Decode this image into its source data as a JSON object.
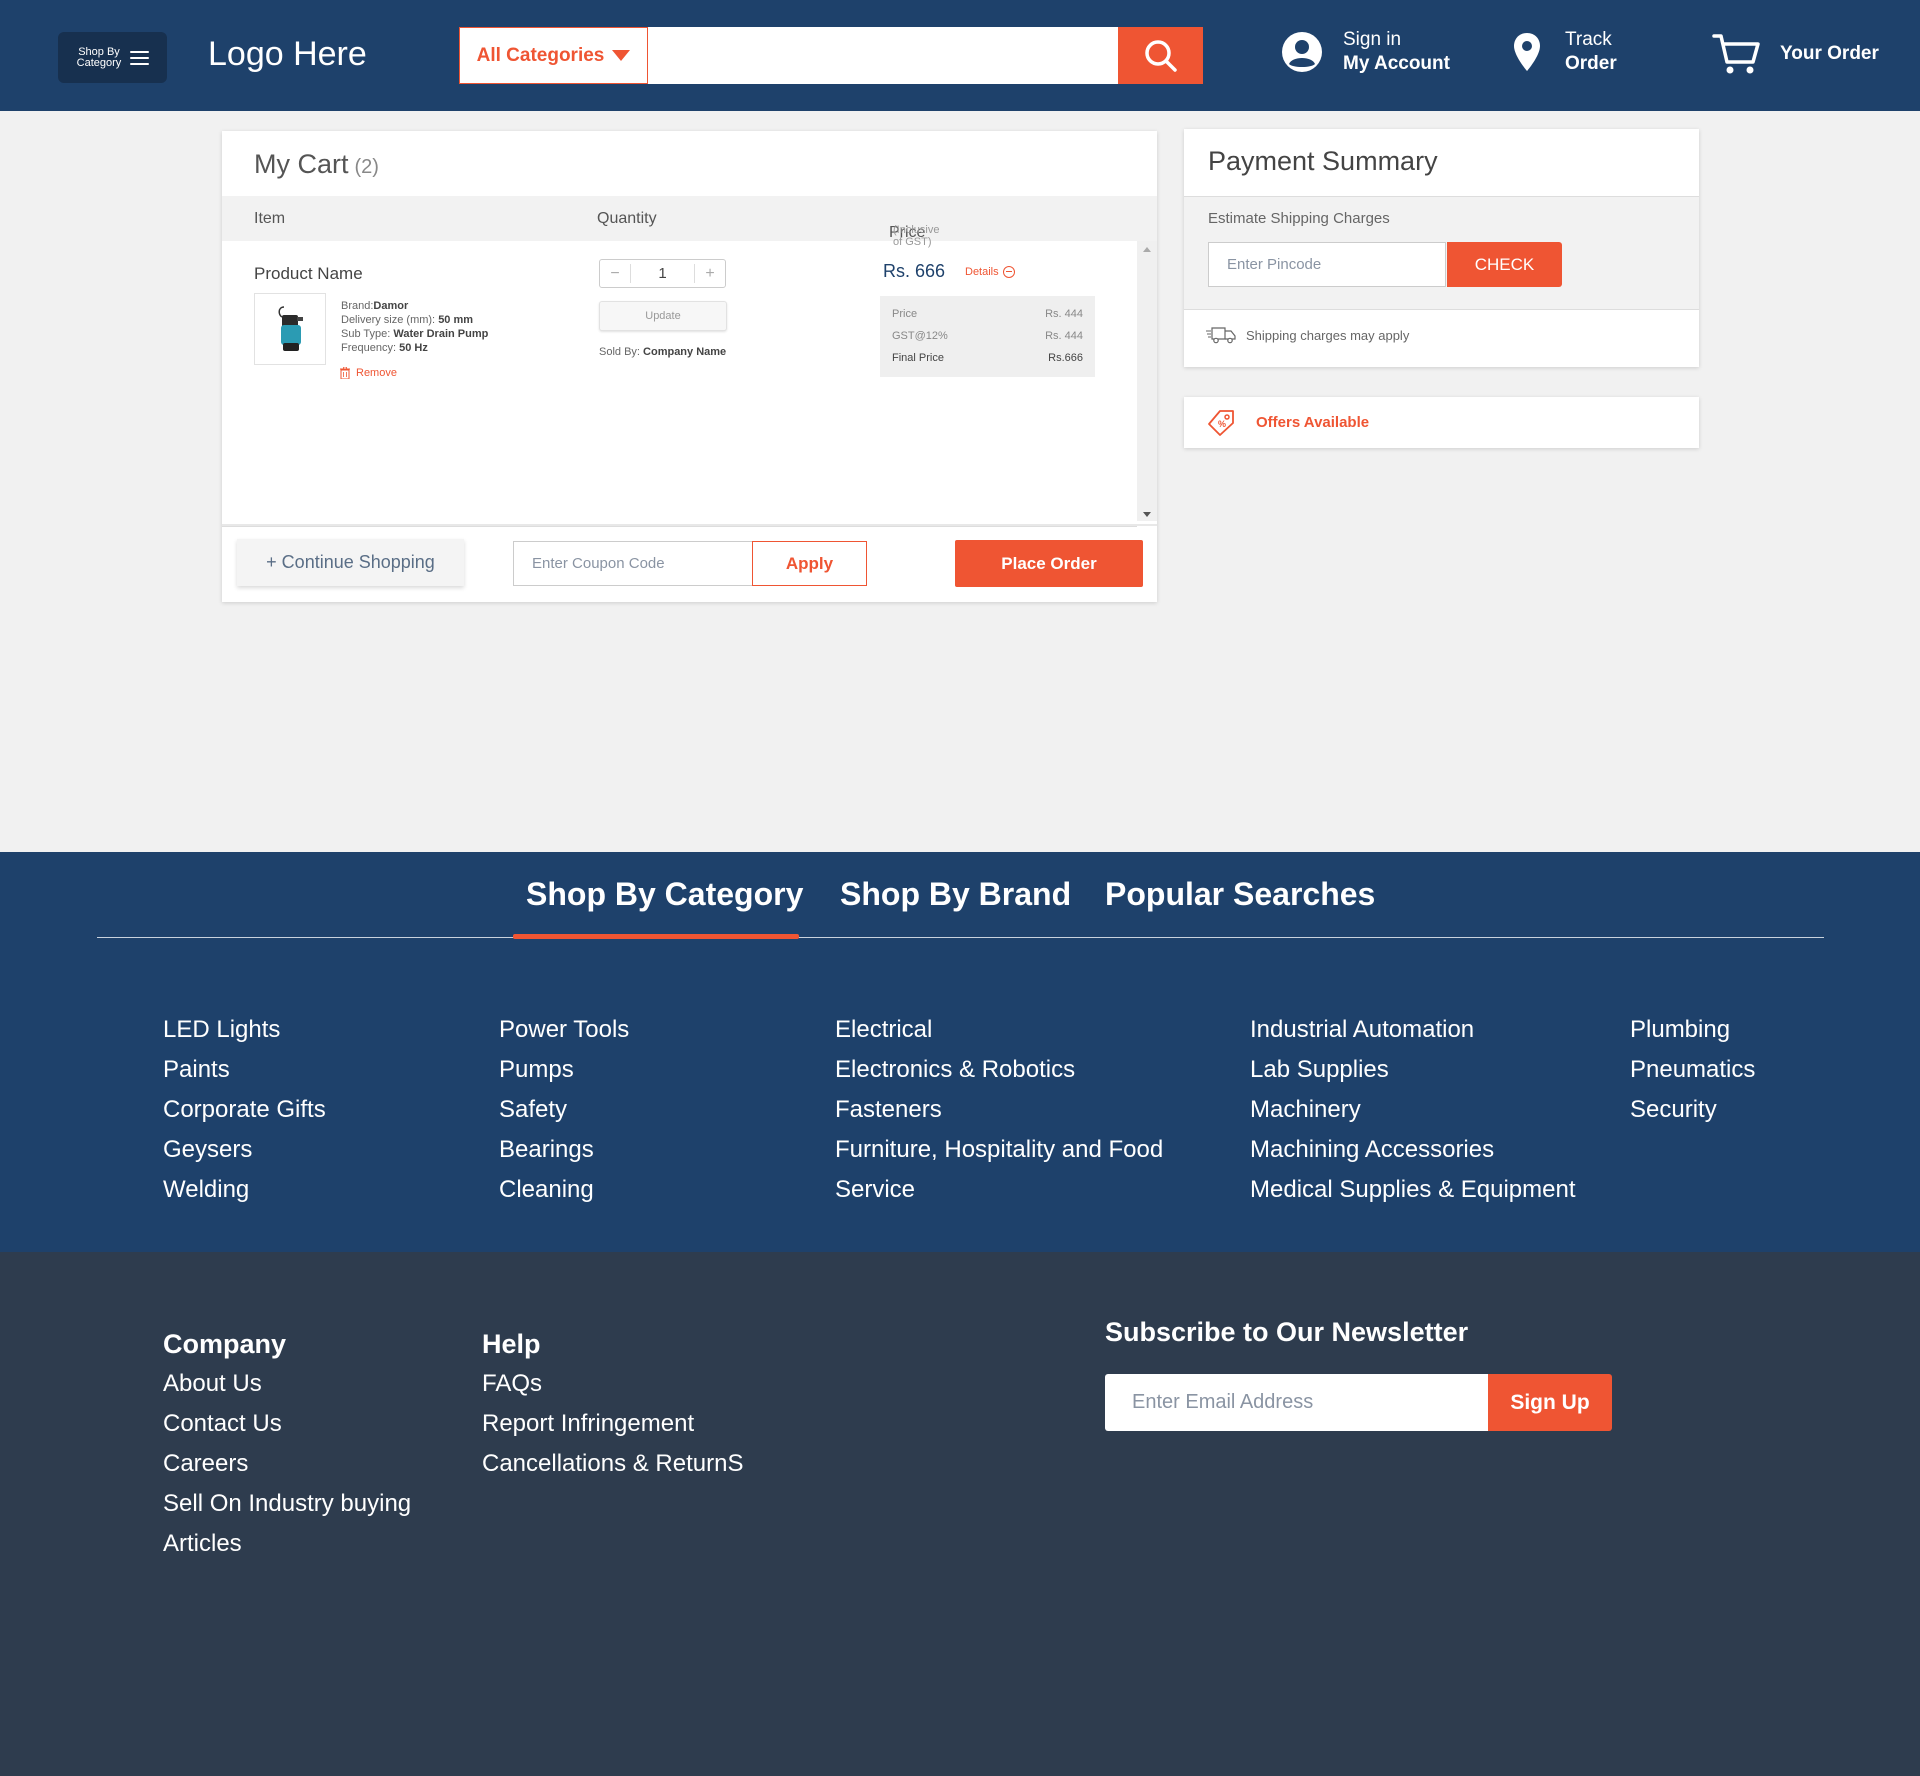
{
  "header": {
    "shop_by_category": "Shop By Category",
    "logo": "Logo Here",
    "category_select": "All Categories",
    "search_placeholder": "",
    "account": {
      "line1": "Sign in",
      "line2": "My Account"
    },
    "track": {
      "line1": "Track",
      "line2": "Order"
    },
    "orders": "Your Order"
  },
  "cart": {
    "title": "My Cart",
    "count": "(2)",
    "columns": {
      "item": "Item",
      "quantity": "Quantity",
      "price": "Price",
      "price_note": "(Inclusive of GST)"
    },
    "item": {
      "name": "Product Name",
      "brand_label": "Brand:",
      "brand": "Damor",
      "delivery_label": "Delivery size (mm):",
      "delivery": "50 mm",
      "subtype_label": "Sub Type:",
      "subtype": "Water Drain Pump",
      "frequency_label": "Frequency:",
      "frequency": "50 Hz",
      "remove": "Remove",
      "quantity": "1",
      "minus": "−",
      "plus": "+",
      "update": "Update",
      "sold_by_label": "Sold By:",
      "sold_by": "Company Name",
      "price": "Rs. 666",
      "details": "Details",
      "breakdown": [
        {
          "label": "Price",
          "value": "Rs. 444"
        },
        {
          "label": "GST@12%",
          "value": "Rs. 444"
        },
        {
          "label": "Final Price",
          "value": "Rs.666"
        }
      ]
    },
    "continue_shopping": "+ Continue Shopping",
    "coupon_placeholder": "Enter Coupon Code",
    "apply": "Apply",
    "place_order": "Place Order"
  },
  "payment": {
    "title": "Payment Summary",
    "estimate_label": "Estimate Shipping Charges",
    "pincode_placeholder": "Enter Pincode",
    "check": "CHECK",
    "shipping_note": "Shipping charges may apply",
    "offers": "Offers Available"
  },
  "footer_categories": {
    "tabs": [
      "Shop By Category",
      "Shop By Brand",
      "Popular Searches"
    ],
    "columns": [
      [
        "LED Lights",
        "Paints",
        "Corporate Gifts",
        "Geysers",
        "Welding"
      ],
      [
        "Power Tools",
        "Pumps",
        "Safety",
        "Bearings",
        "Cleaning"
      ],
      [
        "Electrical",
        "Electronics & Robotics",
        "Fasteners",
        "Furniture, Hospitality and Food",
        "Service"
      ],
      [
        "Industrial Automation",
        "Lab Supplies",
        "Machinery",
        "Machining Accessories",
        "Medical Supplies & Equipment"
      ],
      [
        "Plumbing",
        "Pneumatics",
        "Security"
      ]
    ]
  },
  "footer": {
    "company": {
      "heading": "Company",
      "links": [
        "About Us",
        "Contact Us",
        "Careers",
        "Sell On Industry buying",
        "Articles"
      ]
    },
    "help": {
      "heading": "Help",
      "links": [
        "FAQs",
        "Report Infringement",
        "Cancellations & ReturnS"
      ]
    },
    "newsletter": {
      "title": "Subscribe to Our Newsletter",
      "placeholder": "Enter Email Address",
      "button": "Sign Up"
    }
  },
  "colors": {
    "primary": "#1e416b",
    "accent": "#ef5533",
    "footer_dark": "#2e3c4e",
    "page_bg": "#f1f1f1"
  }
}
